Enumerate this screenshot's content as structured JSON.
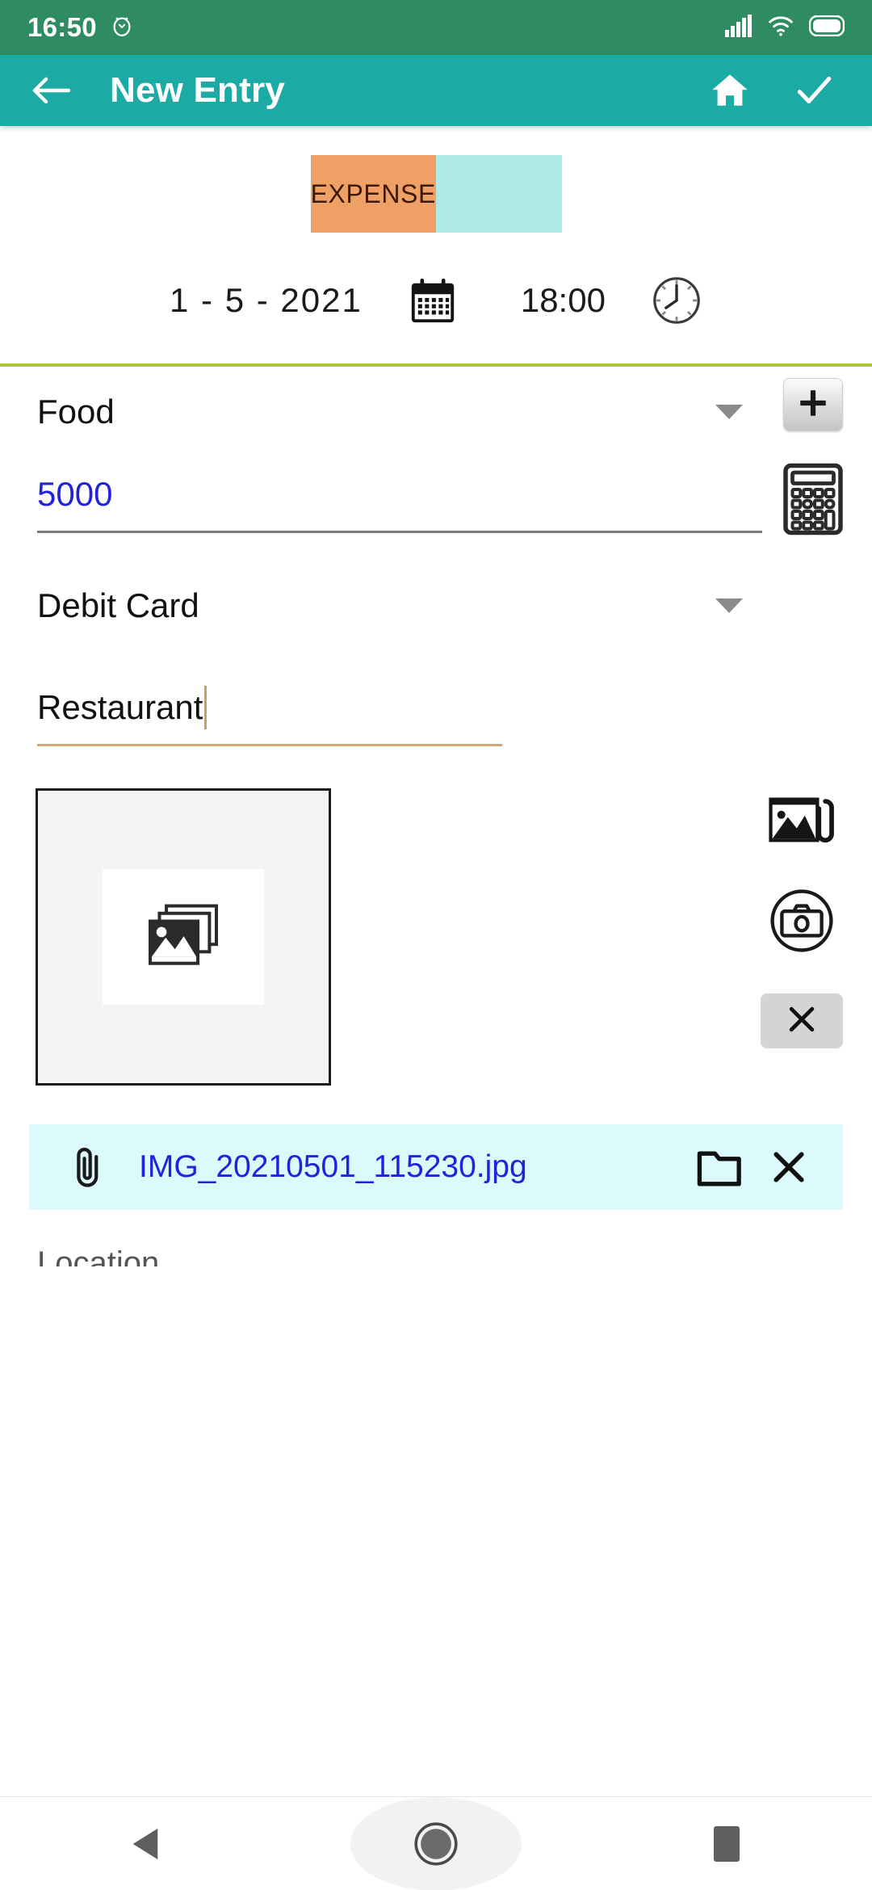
{
  "status_bar": {
    "time": "16:50",
    "alarm_icon": "alarm-icon",
    "signal_icon": "cellular-signal-icon",
    "wifi_icon": "wifi-icon",
    "battery_icon": "battery-icon",
    "background_color": "#2E8B62"
  },
  "app_bar": {
    "title": "New Entry",
    "back_icon": "back-arrow-icon",
    "home_icon": "home-icon",
    "confirm_icon": "checkmark-icon",
    "background_color": "#1CABA4"
  },
  "entry_type": {
    "expense_label": "EXPENSE",
    "income_label": "",
    "selected": "EXPENSE",
    "expense_color": "#EFA065",
    "income_color": "#ADE9E6"
  },
  "datetime": {
    "date": "1 - 5 - 2021",
    "calendar_icon": "calendar-icon",
    "time": "18:00",
    "clock_icon": "clock-icon"
  },
  "divider_color": "#A9C23F",
  "fields": {
    "category": {
      "value": "Food",
      "caret_icon": "chevron-down-icon",
      "add_icon": "plus-icon"
    },
    "amount": {
      "value": "5000",
      "color": "#2222DD",
      "calculator_icon": "calculator-icon"
    },
    "payment_method": {
      "value": "Debit Card",
      "caret_icon": "chevron-down-icon"
    },
    "note": {
      "value": "Restaurant",
      "underline_color": "#D2AA73"
    }
  },
  "image_preview": {
    "placeholder_icon": "photo-stack-icon",
    "gallery_icon": "image-attach-icon",
    "camera_icon": "camera-icon",
    "clear_icon": "close-x-icon"
  },
  "attachment": {
    "clip_icon": "paperclip-icon",
    "filename": "IMG_20210501_115230.jpg",
    "folder_icon": "folder-icon",
    "remove_icon": "close-x-icon",
    "background_color": "#DCFAFC",
    "text_color": "#2222DD"
  },
  "cutoff": {
    "label": "Location"
  },
  "nav_bar": {
    "back_icon": "nav-back-triangle-icon",
    "home_icon": "nav-home-circle-icon",
    "recents_icon": "nav-recents-square-icon"
  }
}
